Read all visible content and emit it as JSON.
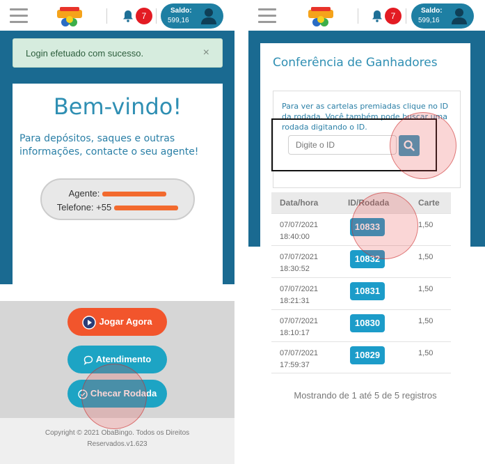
{
  "left": {
    "header": {
      "notif_count": "7",
      "saldo_label": "Saldo:",
      "saldo_value": "599,16"
    },
    "alert": {
      "text": "Login efetuado com sucesso.",
      "close": "×"
    },
    "welcome": {
      "title": "Bem-vindo!",
      "info": "Para depósitos, saques e outras informações, contacte o seu agente!",
      "agent_label": "Agente:",
      "phone_label": "Telefone: +55"
    },
    "buttons": {
      "play": "Jogar Agora",
      "support": "Atendimento",
      "check": "Checar Rodada"
    },
    "footer": {
      "line1": "Copyright © 2021 ObaBingo. Todos os Direitos",
      "line2": "Reservados.v1.623"
    }
  },
  "right": {
    "header": {
      "notif_count": "7",
      "saldo_label": "Saldo:",
      "saldo_value": "599,16"
    },
    "title": "Conferência de Ganhadores",
    "hint": "Para ver as cartelas premiadas clique no ID da rodada. Você também pode buscar uma rodada digitando o ID.",
    "search_placeholder": "Digite o ID",
    "table": {
      "headers": [
        "Data/hora",
        "ID/Rodada",
        "Carte"
      ],
      "rows": [
        {
          "date": "07/07/2021",
          "time": "18:40:00",
          "id": "10833",
          "value": "1,50"
        },
        {
          "date": "07/07/2021",
          "time": "18:30:52",
          "id": "10832",
          "value": "1,50"
        },
        {
          "date": "07/07/2021",
          "time": "18:21:31",
          "id": "10831",
          "value": "1,50"
        },
        {
          "date": "07/07/2021",
          "time": "18:10:17",
          "id": "10830",
          "value": "1,50"
        },
        {
          "date": "07/07/2021",
          "time": "17:59:37",
          "id": "10829",
          "value": "1,50"
        }
      ]
    },
    "showing": "Mostrando de 1 até 5 de 5 registros"
  },
  "colors": {
    "brand_blue": "#1a6a91",
    "accent_teal": "#1da4c4",
    "play_red": "#f2552c",
    "badge_red": "#e31b23"
  }
}
